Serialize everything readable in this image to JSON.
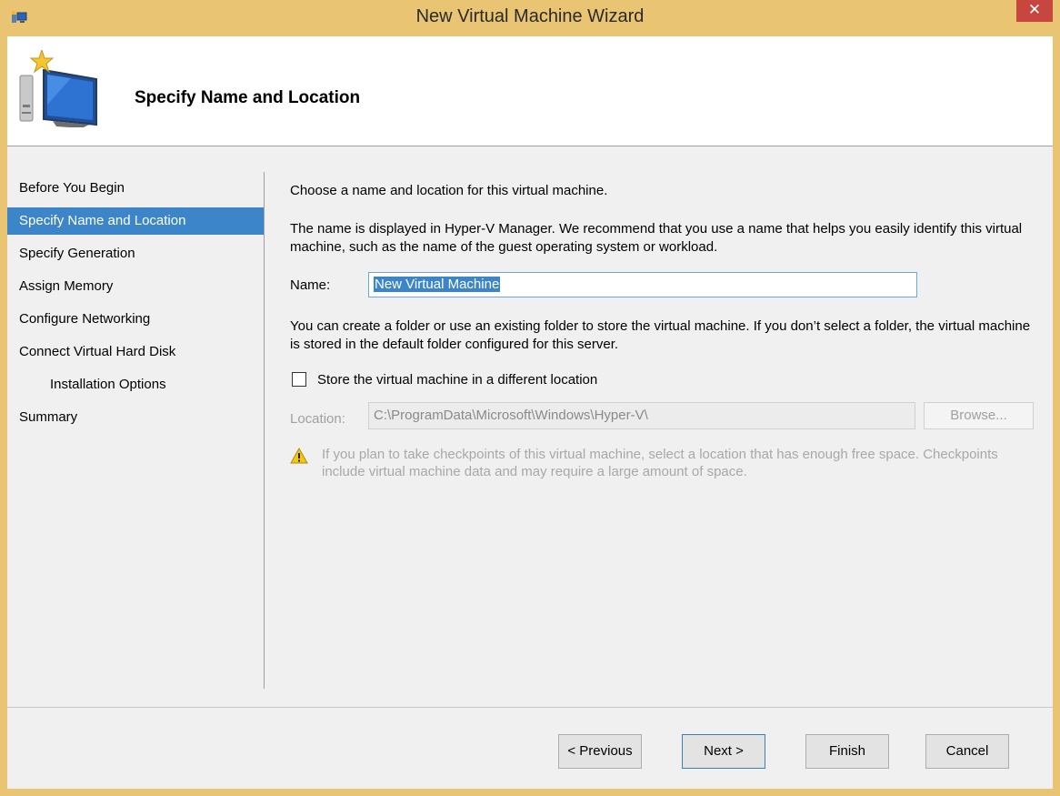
{
  "window": {
    "title": "New Virtual Machine Wizard",
    "close_symbol": "✕"
  },
  "header": {
    "title": "Specify Name and Location"
  },
  "nav": {
    "items": [
      {
        "label": "Before You Begin"
      },
      {
        "label": "Specify Name and Location"
      },
      {
        "label": "Specify Generation"
      },
      {
        "label": "Assign Memory"
      },
      {
        "label": "Configure Networking"
      },
      {
        "label": "Connect Virtual Hard Disk"
      },
      {
        "label": "Installation Options"
      },
      {
        "label": "Summary"
      }
    ]
  },
  "main": {
    "intro": "Choose a name and location for this virtual machine.",
    "name_help": "The name is displayed in Hyper-V Manager. We recommend that you use a name that helps you easily identify this virtual machine, such as the name of the guest operating system or workload.",
    "name_label": "Name:",
    "name_value": "New Virtual Machine",
    "folder_help": "You can create a folder or use an existing folder to store the virtual machine. If you don’t select a folder, the virtual machine is stored in the default folder configured for this server.",
    "store_checkbox_label": "Store the virtual machine in a different location",
    "store_checked": false,
    "location_label": "Location:",
    "location_value": "C:\\ProgramData\\Microsoft\\Windows\\Hyper-V\\",
    "browse_label": "Browse...",
    "warning_text": "If you plan to take checkpoints of this virtual machine, select a location that has enough free space. Checkpoints include virtual machine data and may require a large amount of space."
  },
  "buttons": {
    "previous": "< Previous",
    "next": "Next >",
    "finish": "Finish",
    "cancel": "Cancel"
  },
  "colors": {
    "title_bar": "#e8c473",
    "selection": "#3b85c8",
    "close_button": "#c7463f"
  },
  "icons": [
    "app-icon",
    "close-icon",
    "wizard-computer-icon",
    "warning-icon"
  ]
}
